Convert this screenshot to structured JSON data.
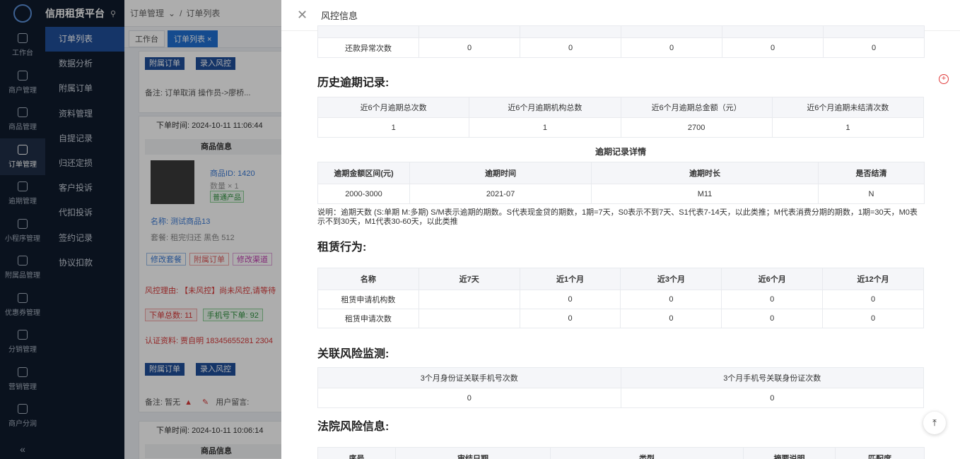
{
  "brand": "信用租赁平台",
  "rail": [
    "工作台",
    "商户管理",
    "商品管理",
    "订单管理",
    "逾期管理",
    "小程序管理",
    "附属品管理",
    "优惠券管理",
    "分销管理",
    "营销管理",
    "商户分润"
  ],
  "subnav": [
    "订单列表",
    "数据分析",
    "附属订单",
    "资料管理",
    "自提记录",
    "归还定损",
    "客户投诉",
    "代扣投诉",
    "签约记录",
    "协议扣款"
  ],
  "breadcrumb": [
    "订单管理",
    "订单列表"
  ],
  "tabs": [
    "工作台",
    "订单列表"
  ],
  "bg": {
    "btns": [
      "附属订单",
      "录入风控"
    ],
    "remark1": "备注: 订单取消 操作员->廖桥...",
    "time1": "下单时间: 2024-10-11 11:06:44",
    "goods_header": "商品信息",
    "goods_id": "商品ID: 1420",
    "qty": "数量 × 1",
    "tag": "普通产品",
    "name": "名称: 测试商品13",
    "pkg": "套餐: 租完归还 黑色 512",
    "act": [
      "修改套餐",
      "附属订单",
      "修改渠道"
    ],
    "risk": "风控理由: 【未风控】尚未风控,请等待",
    "stats": [
      "下单总数: 11",
      "手机号下单: 92"
    ],
    "cert": "认证资料: 贾自明  18345655281  2304",
    "remark2": "备注: 暂无",
    "usermsg": "用户留言:",
    "time2": "下单时间: 2024-10-11 10:06:14"
  },
  "drawer": {
    "title": "风控信息",
    "row0": {
      "label": "还款异常次数",
      "vals": [
        "0",
        "0",
        "0",
        "0",
        "0"
      ]
    },
    "overdue": {
      "title": "历史逾期记录:",
      "headers": [
        "近6个月逾期总次数",
        "近6个月逾期机构总数",
        "近6个月逾期总金额（元）",
        "近6个月逾期未结清次数"
      ],
      "vals": [
        "1",
        "1",
        "2700",
        "1"
      ]
    },
    "detail": {
      "title": "逾期记录详情",
      "headers": [
        "逾期金额区间(元)",
        "逾期时间",
        "逾期时长",
        "是否结清"
      ],
      "vals": [
        "2000-3000",
        "2021-07",
        "M11",
        "N"
      ]
    },
    "note": "说明：逾期天数 (S:单期 M:多期) S/M表示逾期的期数。S代表现金贷的期数，1期=7天，S0表示不到7天、S1代表7-14天，以此类推；M代表消费分期的期数，1期=30天，M0表示不到30天，M1代表30-60天，以此类推",
    "rent": {
      "title": "租赁行为:",
      "headers": [
        "名称",
        "近7天",
        "近1个月",
        "近3个月",
        "近6个月",
        "近12个月"
      ],
      "rows": [
        [
          "租赁申请机构数",
          "",
          "0",
          "0",
          "0",
          "0"
        ],
        [
          "租赁申请次数",
          "",
          "0",
          "0",
          "0",
          "0"
        ]
      ]
    },
    "link": {
      "title": "关联风险监测:",
      "headers": [
        "3个月身份证关联手机号次数",
        "3个月手机号关联身份证次数"
      ],
      "vals": [
        "0",
        "0"
      ]
    },
    "court": {
      "title": "法院风险信息:",
      "headers": [
        "序号",
        "审结日期",
        "类型",
        "摘要说明",
        "匹配度"
      ]
    }
  }
}
